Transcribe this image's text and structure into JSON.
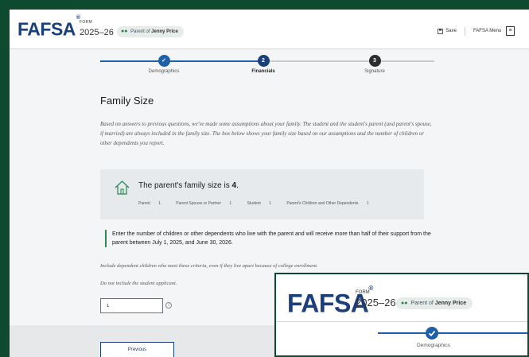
{
  "header": {
    "logo": "FAFSA",
    "trademark": "®",
    "form_label": "FORM",
    "form_year": "2025–26",
    "role_prefix": "Parent of",
    "role_name": "Jenny Price",
    "save_label": "Save",
    "menu_label": "FAFSA Menu"
  },
  "stepper": {
    "steps": [
      {
        "label": "Demographics",
        "state": "complete",
        "marker": "✓"
      },
      {
        "label": "Financials",
        "state": "current",
        "marker": "2"
      },
      {
        "label": "Signature",
        "state": "upcoming",
        "marker": "3"
      }
    ]
  },
  "page": {
    "title": "Family Size",
    "intro": "Based on answers to previous questions, we've made some assumptions about your family. The student and the student's parent (and parent's spouse, if married) are always included in the family size. The box below shows your family size based on our assumptions and the number of children or other dependents you report."
  },
  "family_box": {
    "text_prefix": "The parent's family size is",
    "size": "4",
    "breakdown": [
      {
        "label": "Parent",
        "value": "1"
      },
      {
        "label": "Parent Spouse or Partner",
        "value": "1"
      },
      {
        "label": "Student",
        "value": "1"
      },
      {
        "label": "Parent's Children and Other Dependents",
        "value": "1"
      }
    ]
  },
  "question": {
    "text": "Enter the number of children or other dependents who live with the parent and will receive more than half of their support from the parent between July 1, 2025, and June 30, 2026.",
    "hint1": "Include dependent children who meet these criteria, even if they live apart because of college enrollment.",
    "hint2": "Do not include the student applicant.",
    "input_value": "1"
  },
  "footer": {
    "previous_label": "Previous"
  },
  "overlay": {
    "logo": "FAFSA",
    "trademark": "®",
    "form_label": "FORM",
    "form_year": "2025–26",
    "role_prefix": "Parent of",
    "role_name": "Jenny Price",
    "step_label": "Demographics"
  },
  "colors": {
    "background": "#0d4a30",
    "brand_navy": "#1b3f7a",
    "progress_blue": "#1d5fa8",
    "accent_green": "#2e8a57"
  }
}
